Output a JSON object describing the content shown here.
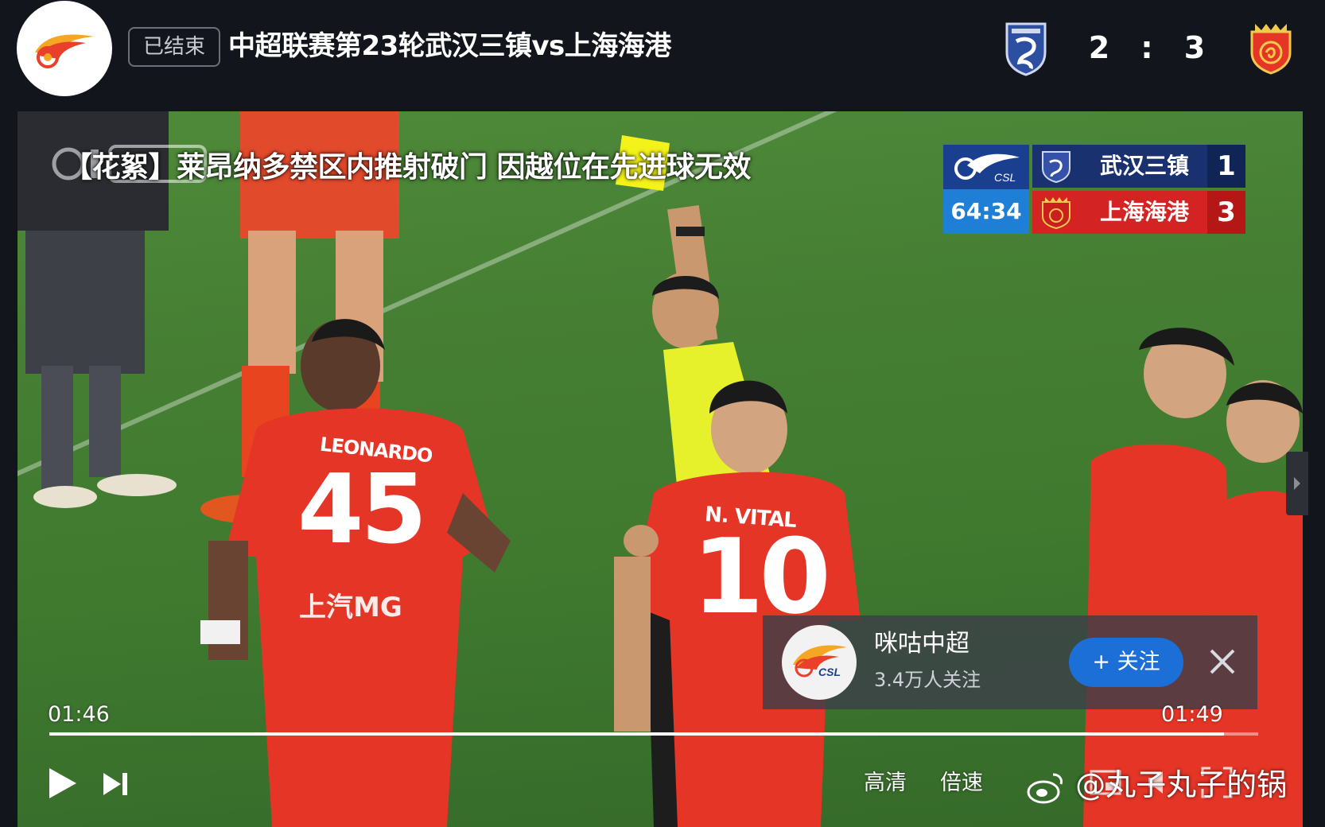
{
  "header": {
    "status": "已结束",
    "title": "中超联赛第23轮武汉三镇vs上海海港",
    "home_score": "2",
    "separator": ":",
    "away_score": "3",
    "logo_icon": "csl-flame-logo",
    "home_badge_icon": "wuhan-three-towns-crest",
    "away_badge_icon": "shanghai-port-crest"
  },
  "video": {
    "caption": "【花絮】莱昂纳多禁区内推射破门 因越位在先进球无效",
    "scoreboard": {
      "league_logo": "CSL",
      "clock": "64:34",
      "home_name": "武汉三镇",
      "home_goals": "1",
      "away_name": "上海海港",
      "away_goals": "3"
    },
    "players": {
      "p45_name": "LEONARDO",
      "p45_number": "45",
      "p10_name": "N. VITAL",
      "p10_number": "10",
      "sponsor": "上汽MG"
    }
  },
  "follow_card": {
    "name": "咪咕中超",
    "followers": "3.4万人关注",
    "button": "+ 关注",
    "avatar_text": "CSL"
  },
  "controls": {
    "current_time": "01:46",
    "total_time": "01:49",
    "progress": 0.972,
    "quality": "高清",
    "speed": "倍速"
  },
  "watermark": {
    "credit": "@丸子丸子的锅"
  },
  "colors": {
    "background": "#13151c",
    "scoreboard_home": "#1a3170",
    "scoreboard_away": "#d32323",
    "follow_button": "#1d6fd8",
    "kit_red": "#e53526"
  }
}
